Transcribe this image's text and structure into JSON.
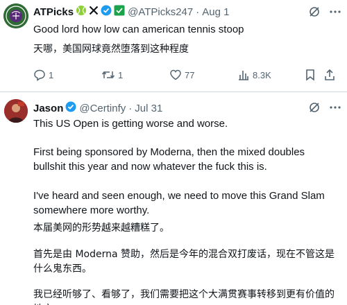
{
  "tweets": [
    {
      "author": {
        "display_name": "ATPicks",
        "handle": "@ATPicks247",
        "date": "Aug 1"
      },
      "badges": [
        "tennis-ball-icon",
        "x-logo-icon",
        "verified-icon",
        "verified-gold-icon"
      ],
      "text_en": "Good lord how low can american tennis stoop",
      "text_zh": "天哪，美国网球竟然堕落到这种程度",
      "stats": {
        "replies": "1",
        "reposts": "1",
        "likes": "77",
        "views": "8.3K"
      }
    },
    {
      "author": {
        "display_name": "Jason",
        "handle": "@Certinfy",
        "date": "Jul 31"
      },
      "badges": [
        "verified-icon"
      ],
      "paragraphs": [
        "This US Open is getting worse and worse.",
        "First being sponsored by Moderna, then the mixed doubles bullshit this year and now whatever the fuck this is.",
        "I've heard and seen enough, we need to move this Grand Slam somewhere more worthy.",
        "本届美网的形势越来越糟糕了。",
        "首先是由 Moderna 赞助，然后是今年的混合双打废话，现在不管这是什么鬼东西。",
        "我已经听够了、看够了，我们需要把这个大满贯赛事转移到更有价值的地方。"
      ]
    }
  ],
  "separator": "·",
  "colors": {
    "text": "#0f1419",
    "secondary": "#536471",
    "verified": "#1d9bf0",
    "gold": "#e2b719",
    "tennis": "#8fcf3a",
    "border": "#cfd9de"
  }
}
